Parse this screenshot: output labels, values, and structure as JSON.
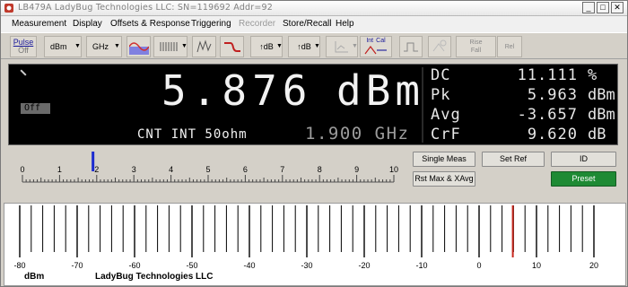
{
  "window": {
    "title": "LB479A  LadyBug Technologies LLC: SN=119692  Addr=92",
    "minimize": "_",
    "maximize": "□",
    "close": "✕"
  },
  "menu": [
    {
      "label": "Measurement",
      "enabled": true
    },
    {
      "label": "Display",
      "enabled": true
    },
    {
      "label": "Offsets & Response",
      "enabled": true
    },
    {
      "label": "Triggering",
      "enabled": true
    },
    {
      "label": "Recorder",
      "enabled": false
    },
    {
      "label": "Store/Recall",
      "enabled": true
    },
    {
      "label": "Help",
      "enabled": true
    }
  ],
  "toolbar": {
    "pulse_label": "Pulse",
    "pulse_state": "Off",
    "unit_select": "dBm",
    "freq_select": "GHz",
    "db_step_1": "↑dB",
    "db_step_2": "↑dB",
    "int_label": "Int",
    "cal_label": "Cal",
    "rise_label": "Rise",
    "fall_label": "Fall",
    "rel_label": "Rel"
  },
  "display": {
    "main_value": "5.876",
    "main_unit": "dBm",
    "avg_state": "Off",
    "info": "CNT  INT  50ohm",
    "frequency": "1.900 GHz",
    "stats": [
      {
        "label": "DC",
        "value": "11.111",
        "unit": "%"
      },
      {
        "label": "Pk",
        "value": "5.963",
        "unit": "dBm"
      },
      {
        "label": "Avg",
        "value": "-3.657",
        "unit": "dBm"
      },
      {
        "label": "CrF",
        "value": "9.620",
        "unit": "dB"
      }
    ],
    "colors": {
      "background": "#000000",
      "text": "#f2f2f2",
      "freq": "#9c9c9c"
    }
  },
  "small_scale": {
    "labels": [
      "0",
      "1",
      "2",
      "3",
      "4",
      "5",
      "6",
      "7",
      "8",
      "9",
      "10"
    ],
    "marker_value": 1.9,
    "marker_color": "#1c2bd0"
  },
  "buttons": {
    "single_meas": "Single Meas",
    "set_ref": "Set Ref",
    "id": "ID",
    "rst_max": "Rst Max & XAvg",
    "preset": "Preset",
    "preset_color": "#1e8a34"
  },
  "big_scale": {
    "labels": [
      "-80",
      "-70",
      "-60",
      "-50",
      "-40",
      "-30",
      "-20",
      "-10",
      "0",
      "10",
      "20"
    ],
    "min": -80,
    "max": 20,
    "marker_value": 5.876,
    "marker_color": "#c8281e",
    "unit_label": "dBm",
    "brand": "LadyBug Technologies LLC"
  }
}
